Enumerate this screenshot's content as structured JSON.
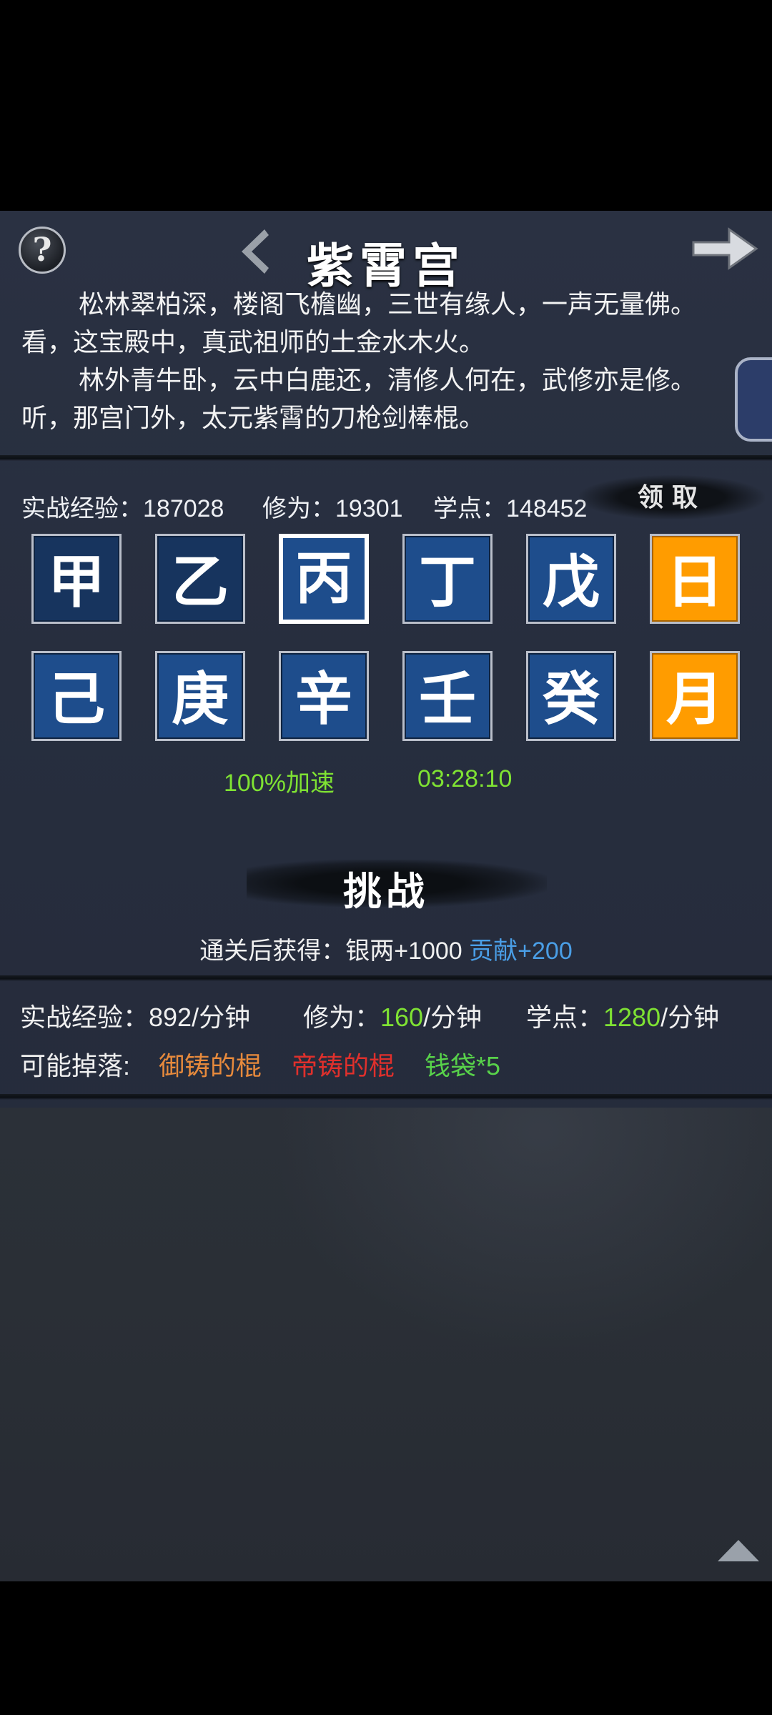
{
  "header": {
    "title": "紫霄宫",
    "help_icon": "question-mark-icon",
    "back_icon": "chevron-left-icon",
    "next_icon": "arrow-right-icon"
  },
  "intro": {
    "para1": "松林翠柏深，楼阁飞檐幽，三世有缘人，一声无量佛。看，这宝殿中，真武祖师的土金水木火。",
    "para2": "林外青牛卧，云中白鹿还，清修人何在，武修亦是修。听，那宫门外，太元紫霄的刀枪剑棒棍。"
  },
  "stats": {
    "exp_label": "实战经验：187028",
    "cult_label": "修为：19301",
    "points_label": "学点：148452",
    "claim_label": "领取"
  },
  "grid": {
    "row1": [
      "甲",
      "乙",
      "丙",
      "丁",
      "戊",
      "日"
    ],
    "row2": [
      "己",
      "庚",
      "辛",
      "壬",
      "癸",
      "月"
    ],
    "selected": "丙"
  },
  "speed_text": "100%加速",
  "timer_text": "03:28:10",
  "challenge": {
    "title": "挑战",
    "reward_prefix": "通关后获得：银两+1000 ",
    "reward_contrib": "贡献+200"
  },
  "rates": {
    "exp_label": "实战经验：892/分钟",
    "cult_prefix": "修为：",
    "cult_value": "160",
    "cult_suffix": "/分钟",
    "points_prefix": "学点：",
    "points_value": "1280",
    "points_suffix": "/分钟"
  },
  "drops": {
    "label": "可能掉落:",
    "item1": "御铸的棍",
    "item2": "帝铸的棍",
    "item3": "钱袋*5"
  },
  "colors": {
    "accent_gold": "#ff9c00",
    "tile_blue": "#1e4d8c",
    "green": "#7fe233",
    "blue": "#4a9ee6",
    "orange": "#e78a3c",
    "red": "#e0302c"
  }
}
